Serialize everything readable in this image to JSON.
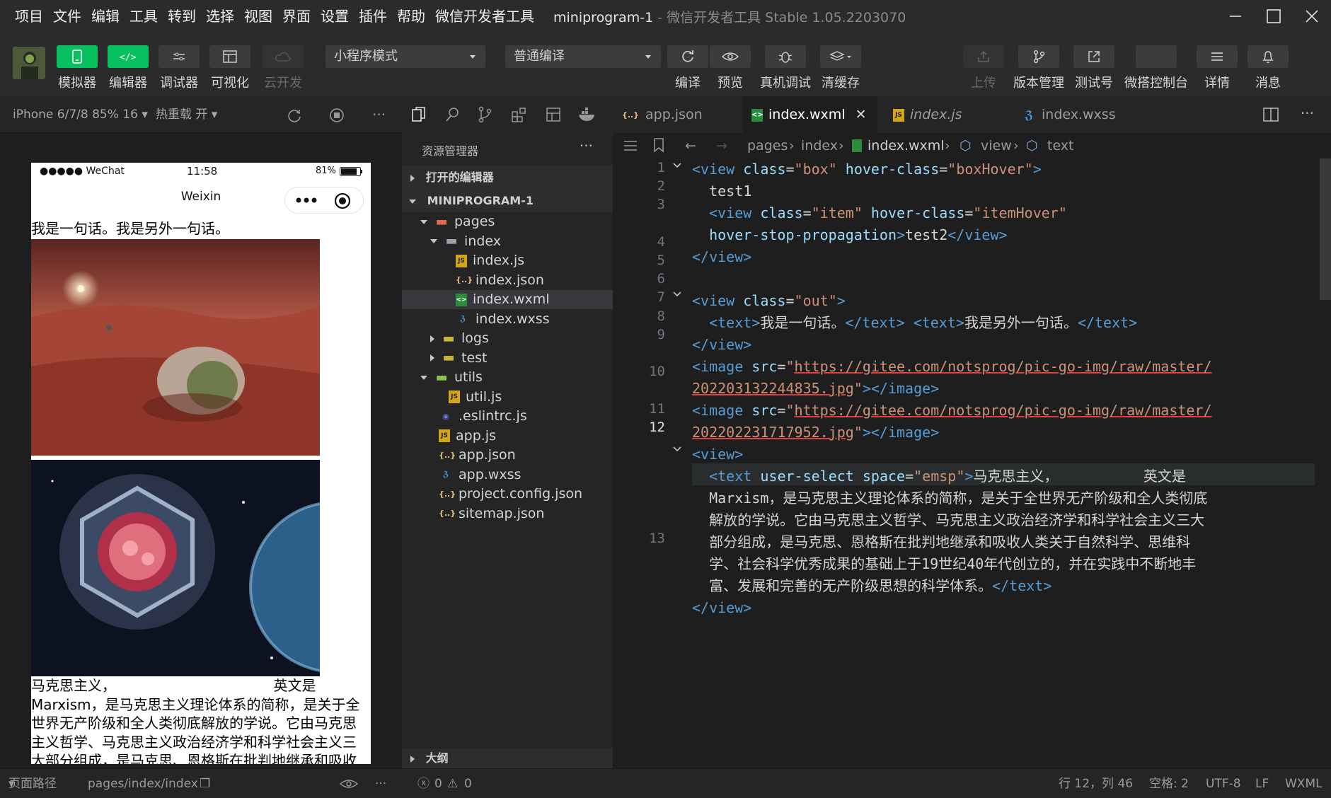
{
  "menubar": {
    "items": [
      "项目",
      "文件",
      "编辑",
      "工具",
      "转到",
      "选择",
      "视图",
      "界面",
      "设置",
      "插件",
      "帮助",
      "微信开发者工具"
    ],
    "title": "miniprogram-1",
    "subtitle": "- 微信开发者工具 Stable 1.05.2203070"
  },
  "toolbar": {
    "simulator": "模拟器",
    "editor": "编辑器",
    "debugger": "调试器",
    "visual": "可视化",
    "cloud": "云开发",
    "mode_select": "小程序模式",
    "compile_select": "普通编译",
    "compile": "编译",
    "preview": "预览",
    "device_debug": "真机调试",
    "clear_cache": "清缓存",
    "upload": "上传",
    "version": "版本管理",
    "test_id": "测试号",
    "wechat_console": "微搭控制台",
    "details": "详情",
    "messages": "消息"
  },
  "simulator": {
    "device": "iPhone 6/7/8 85% 16",
    "hot_reload": "热重载 开",
    "status_left": "●●●●● WeChat",
    "status_time": "11:58",
    "status_battery": "81%",
    "nav_title": "Weixin",
    "line1": "我是一句话。我是另外一句话。",
    "para_lines": [
      "马克思主义，                                   英文是",
      "Marxism，是马克思主义理论体系的简称，是关于全",
      "世界无产阶级和全人类彻底解放的学说。它由马克思",
      "主义哲学、马克思主义政治经济学和科学社会主义三",
      "大部分组成，是马克思、恩格斯在批判地继承和吸收"
    ]
  },
  "explorer": {
    "title": "资源管理器",
    "open_editors": "打开的编辑器",
    "project": "MINIPROGRAM-1",
    "outline": "大纲",
    "tree": [
      {
        "label": "pages",
        "type": "folder-pages",
        "open": true
      },
      {
        "label": "index",
        "type": "folder",
        "open": true
      },
      {
        "label": "index.js",
        "type": "js"
      },
      {
        "label": "index.json",
        "type": "json"
      },
      {
        "label": "index.wxml",
        "type": "wxml"
      },
      {
        "label": "index.wxss",
        "type": "wxss"
      },
      {
        "label": "logs",
        "type": "folder-closed"
      },
      {
        "label": "test",
        "type": "folder-closed"
      },
      {
        "label": "utils",
        "type": "folder-open"
      },
      {
        "label": "util.js",
        "type": "js"
      },
      {
        "label": ".eslintrc.js",
        "type": "eslint"
      },
      {
        "label": "app.js",
        "type": "js"
      },
      {
        "label": "app.json",
        "type": "json"
      },
      {
        "label": "app.wxss",
        "type": "wxss"
      },
      {
        "label": "project.config.json",
        "type": "json"
      },
      {
        "label": "sitemap.json",
        "type": "json"
      }
    ]
  },
  "editor": {
    "tabs": [
      "app.json",
      "index.wxml",
      "index.js",
      "index.wxss"
    ],
    "breadcrumbs": [
      "pages",
      "index",
      "index.wxml",
      "view",
      "text"
    ],
    "line_numbers": [
      "1",
      "2",
      "3",
      "",
      "4",
      "5",
      "6",
      "7",
      "8",
      "9",
      "",
      "10",
      "",
      "11",
      "12",
      "",
      "",
      "",
      "",
      "",
      "13"
    ]
  },
  "statusbar": {
    "page_path_label": "页面路径",
    "page_path": "pages/index/index",
    "errors": "0",
    "warnings": "0",
    "position": "行 12，列 46",
    "spaces": "空格: 2",
    "encoding": "UTF-8",
    "eol": "LF",
    "language": "WXML"
  },
  "colors": {
    "accent_green": "#07c160",
    "bg": "#1e1e1e",
    "panel": "#252526"
  }
}
